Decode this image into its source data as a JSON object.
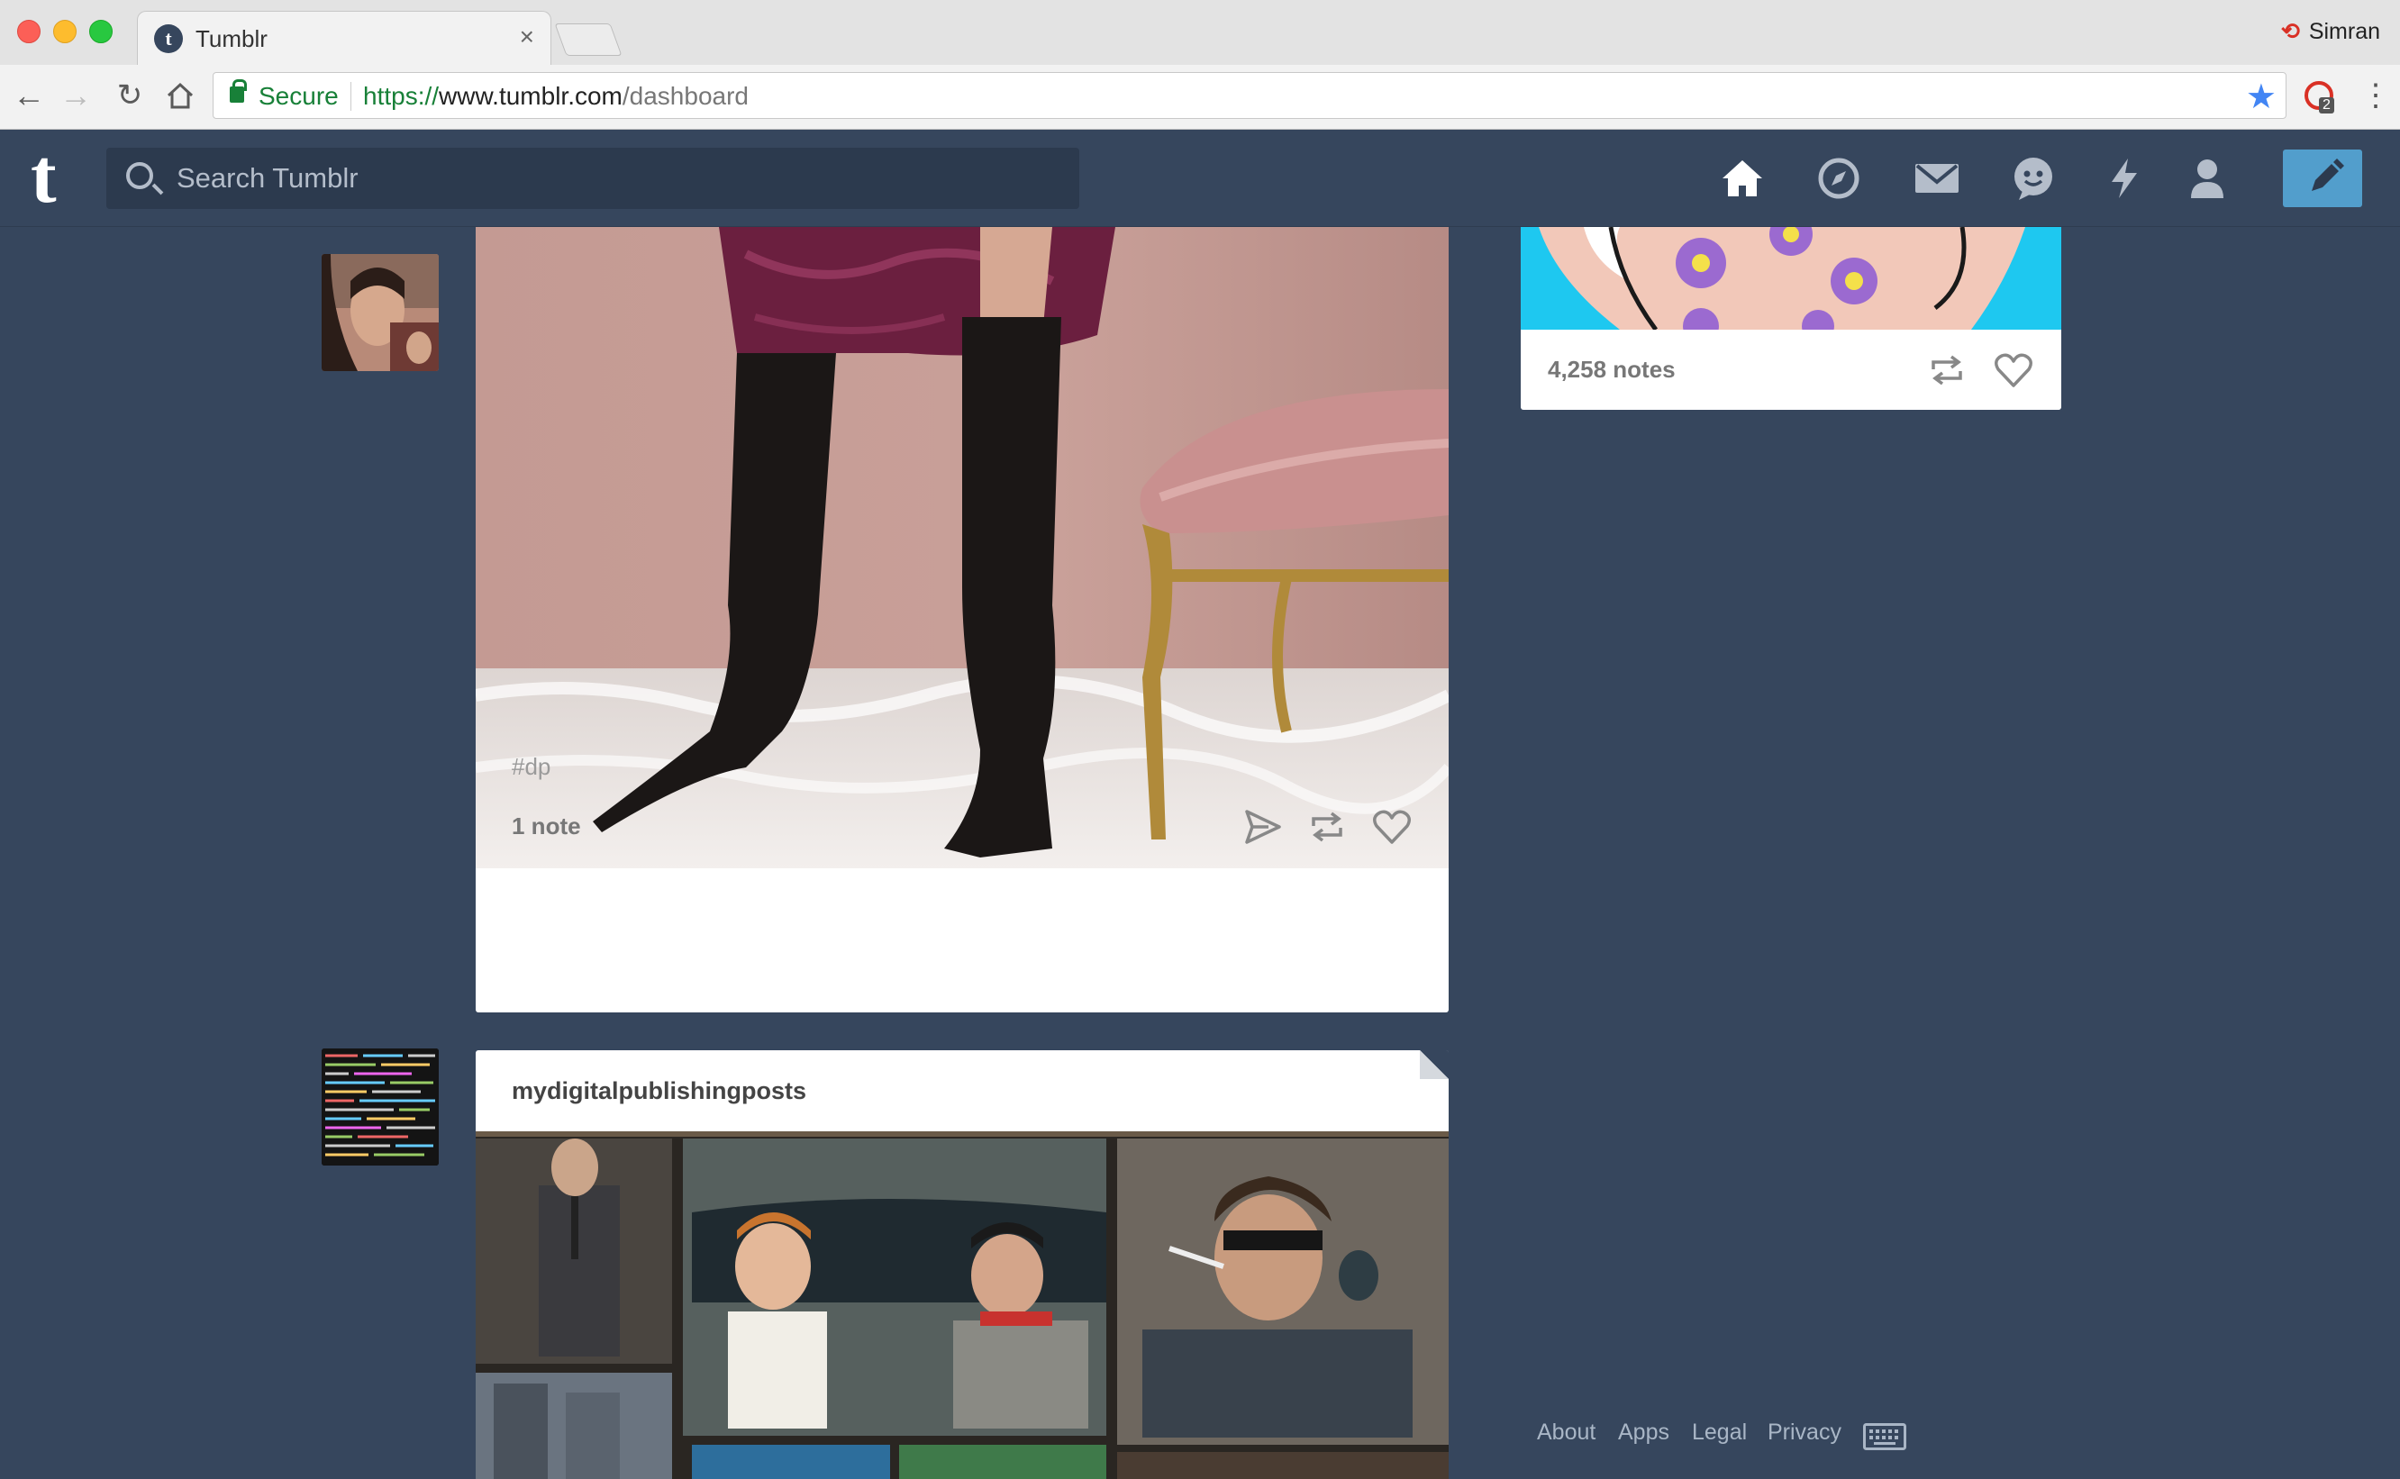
{
  "browser": {
    "tab_title": "Tumblr",
    "tab_close": "×",
    "profile_name": "Simran",
    "secure_label": "Secure",
    "url_scheme": "https://",
    "url_host": "www.tumblr.com",
    "url_path": "/dashboard",
    "extension_badge": "2"
  },
  "header": {
    "logo": "t",
    "search_placeholder": "Search Tumblr",
    "nav_icons": [
      "home-icon",
      "explore-icon",
      "inbox-icon",
      "messaging-icon",
      "activity-icon",
      "account-icon"
    ],
    "compose_icon": "pencil-icon"
  },
  "posts": [
    {
      "tag": "#dp",
      "notes": "1 note",
      "actions": [
        "share-icon",
        "reblog-icon",
        "like-icon"
      ]
    },
    {
      "blog_name": "mydigitalpublishingposts"
    }
  ],
  "sidebar_post": {
    "notes": "4,258 notes",
    "actions": [
      "reblog-icon",
      "like-icon"
    ]
  },
  "footer": {
    "links": [
      "About",
      "Apps",
      "Legal",
      "Privacy"
    ],
    "keyboard_icon": "keyboard-icon"
  },
  "colors": {
    "dashboard_bg": "#36465d",
    "compose_button": "#529ecc",
    "secure_green": "#188038",
    "star_blue": "#4285f4"
  }
}
